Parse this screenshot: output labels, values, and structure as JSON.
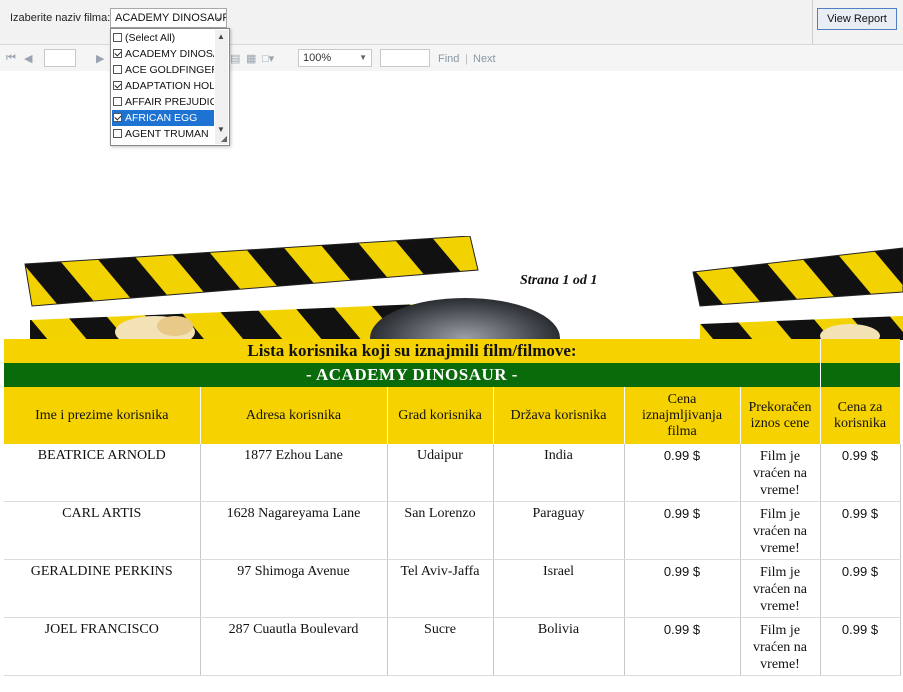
{
  "parameter": {
    "label": "Izaberite naziv filma:",
    "selected_value": "ACADEMY DINOSAUR",
    "view_report_label": "View Report"
  },
  "dropdown": {
    "items": [
      {
        "label": "(Select All)",
        "checked": false,
        "highlighted": false
      },
      {
        "label": "ACADEMY DINOSAUR",
        "checked": true,
        "highlighted": false
      },
      {
        "label": "ACE GOLDFINGER",
        "checked": false,
        "highlighted": false
      },
      {
        "label": "ADAPTATION HOLES",
        "checked": true,
        "highlighted": false
      },
      {
        "label": "AFFAIR PREJUDICE",
        "checked": false,
        "highlighted": false
      },
      {
        "label": "AFRICAN EGG",
        "checked": true,
        "highlighted": true
      },
      {
        "label": "AGENT TRUMAN",
        "checked": false,
        "highlighted": false
      }
    ]
  },
  "toolbar": {
    "zoom": "100%",
    "find_label": "Find",
    "next_label": "Next",
    "separator": "|"
  },
  "report": {
    "page_info": "Strana 1 od 1",
    "title": "Lista korisnika koji su iznajmili film/filmove:",
    "film_title": "- ACADEMY DINOSAUR -",
    "columns": [
      "Ime i prezime korisnika",
      "Adresa korisnika",
      "Grad korisnika",
      "Država korisnika",
      "Cena iznajmljivanja filma",
      "Prekoračen iznos cene",
      "Cena za korisnika"
    ],
    "rows": [
      {
        "name": "BEATRICE ARNOLD",
        "address": "1877 Ezhou Lane",
        "city": "Udaipur",
        "country": "India",
        "price": "0.99 $",
        "overdue": "Film je vraćen na vreme!",
        "total": "0.99 $"
      },
      {
        "name": "CARL ARTIS",
        "address": "1628 Nagareyama Lane",
        "city": "San Lorenzo",
        "country": "Paraguay",
        "price": "0.99 $",
        "overdue": "Film je vraćen na vreme!",
        "total": "0.99 $"
      },
      {
        "name": "GERALDINE PERKINS",
        "address": "97 Shimoga Avenue",
        "city": "Tel Aviv-Jaffa",
        "country": "Israel",
        "price": "0.99 $",
        "overdue": "Film je vraćen na vreme!",
        "total": "0.99 $"
      },
      {
        "name": "JOEL FRANCISCO",
        "address": "287 Cuautla Boulevard",
        "city": "Sucre",
        "country": "Bolivia",
        "price": "0.99 $",
        "overdue": "Film je vraćen na vreme!",
        "total": "0.99 $"
      }
    ]
  },
  "colors": {
    "header_yellow": "#f6d300",
    "film_green": "#0a6b0a",
    "selection_blue": "#1e73d2"
  }
}
